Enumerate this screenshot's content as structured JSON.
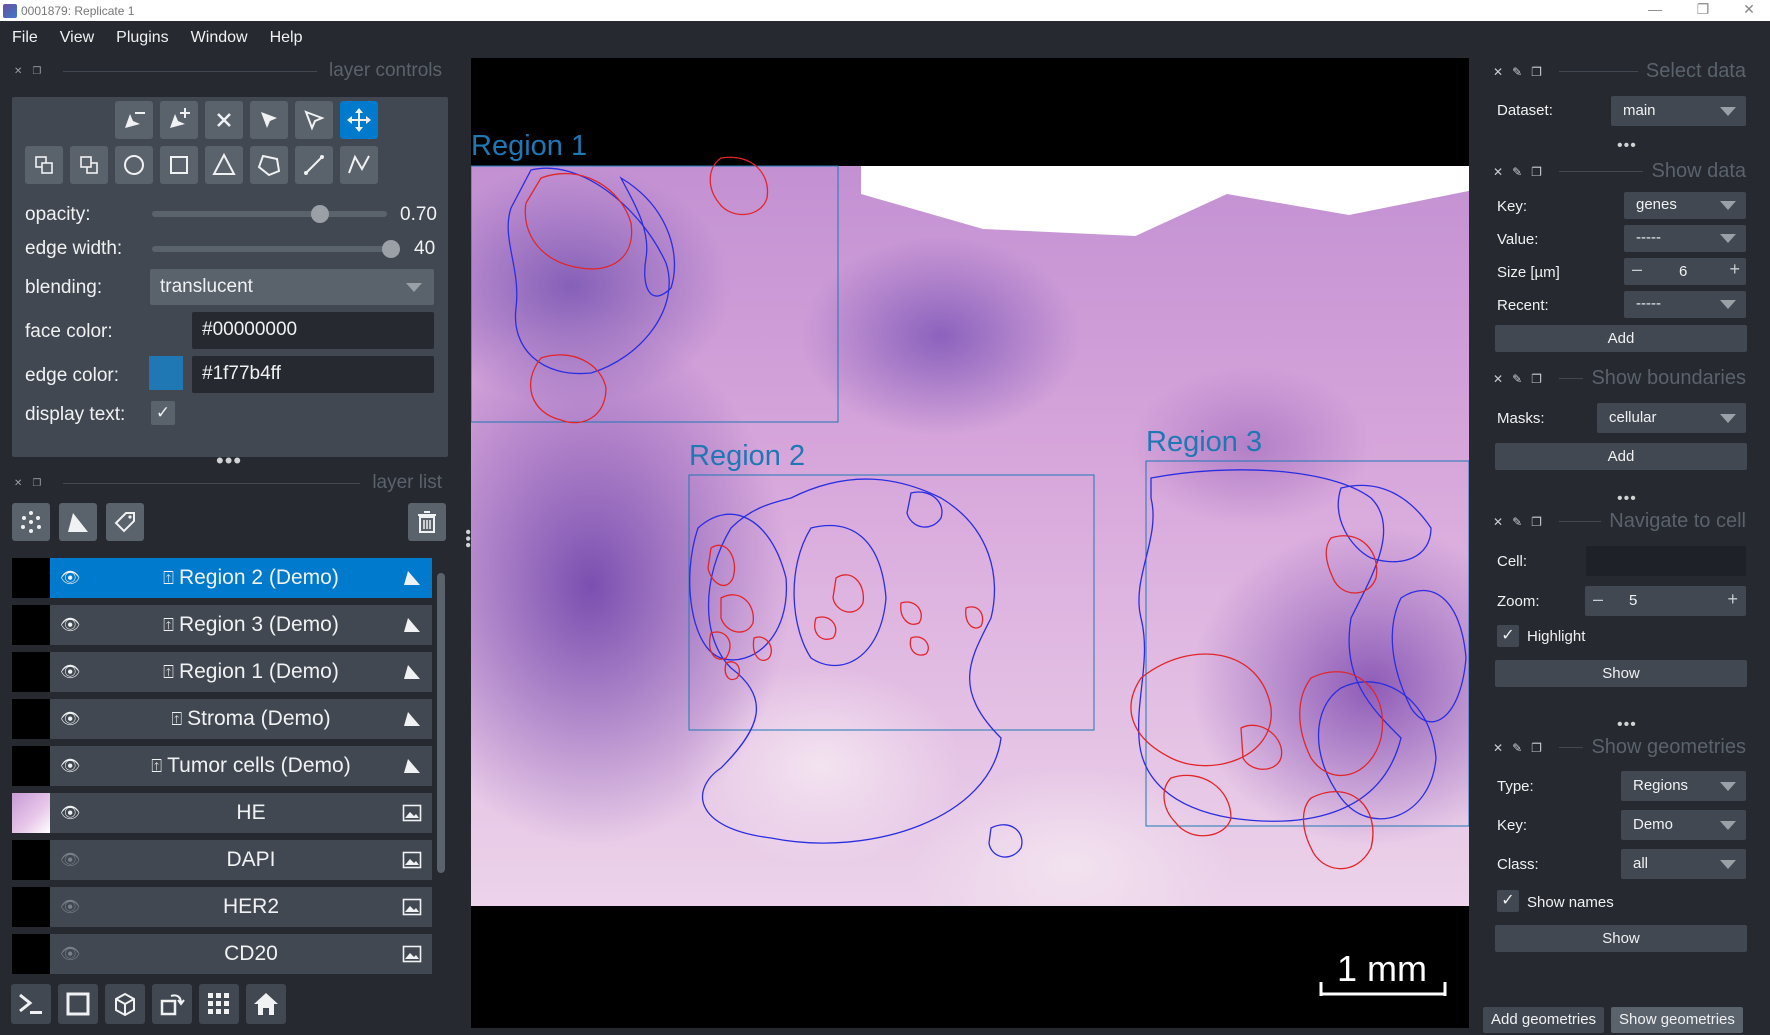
{
  "window": {
    "title": "0001879: Replicate 1"
  },
  "menu": [
    "File",
    "View",
    "Plugins",
    "Window",
    "Help"
  ],
  "layer_controls": {
    "title": "layer controls",
    "opacity_label": "opacity:",
    "opacity_value": "0.70",
    "edge_width_label": "edge width:",
    "edge_width_value": "40",
    "blending_label": "blending:",
    "blending_value": "translucent",
    "face_color_label": "face color:",
    "face_color_value": "#00000000",
    "edge_color_label": "edge color:",
    "edge_color_value": "#1f77b4ff",
    "display_text_label": "display text:",
    "display_text_checked": true,
    "colors": {
      "edge": "#1f77b4"
    }
  },
  "layer_list": {
    "title": "layer list",
    "layers": [
      {
        "name": "Region 2 (Demo)",
        "type": "shapes",
        "visible": true,
        "selected": true
      },
      {
        "name": "Region 3 (Demo)",
        "type": "shapes",
        "visible": true
      },
      {
        "name": "Region 1 (Demo)",
        "type": "shapes",
        "visible": true
      },
      {
        "name": "Stroma (Demo)",
        "type": "shapes",
        "visible": true
      },
      {
        "name": "Tumor cells (Demo)",
        "type": "shapes",
        "visible": true
      },
      {
        "name": "HE",
        "type": "image",
        "visible": true
      },
      {
        "name": "DAPI",
        "type": "image",
        "visible": false
      },
      {
        "name": "HER2",
        "type": "image",
        "visible": false
      },
      {
        "name": "CD20",
        "type": "image",
        "visible": false
      }
    ]
  },
  "canvas": {
    "regions": [
      {
        "label": "Region 1"
      },
      {
        "label": "Region 2"
      },
      {
        "label": "Region 3"
      }
    ],
    "scalebar": "1 mm"
  },
  "right_panel": {
    "select_data": {
      "title": "Select data",
      "dataset_label": "Dataset:",
      "dataset_value": "main"
    },
    "show_data": {
      "title": "Show data",
      "key_label": "Key:",
      "key_value": "genes",
      "value_label": "Value:",
      "value_value": "-----",
      "size_label": "Size [µm]",
      "size_value": "6",
      "recent_label": "Recent:",
      "recent_value": "-----",
      "add_button": "Add"
    },
    "show_boundaries": {
      "title": "Show boundaries",
      "masks_label": "Masks:",
      "masks_value": "cellular",
      "add_button": "Add"
    },
    "navigate": {
      "title": "Navigate to cell",
      "cell_label": "Cell:",
      "cell_value": "",
      "zoom_label": "Zoom:",
      "zoom_value": "5",
      "highlight_label": "Highlight",
      "highlight_checked": true,
      "show_button": "Show"
    },
    "show_geometries": {
      "title": "Show geometries",
      "type_label": "Type:",
      "type_value": "Regions",
      "key_label": "Key:",
      "key_value": "Demo",
      "class_label": "Class:",
      "class_value": "all",
      "show_names_label": "Show names",
      "show_names_checked": true,
      "show_button": "Show"
    },
    "tabs": [
      "Add geometries",
      "Show geometries"
    ],
    "active_tab": "Show geometries"
  },
  "colors": {
    "background": "#262930",
    "panel": "#414851",
    "accent": "#007acc",
    "region_outline": "#1f77b4",
    "tumor_outline": "#e0262b",
    "stroma_outline": "#2a2ee0"
  }
}
